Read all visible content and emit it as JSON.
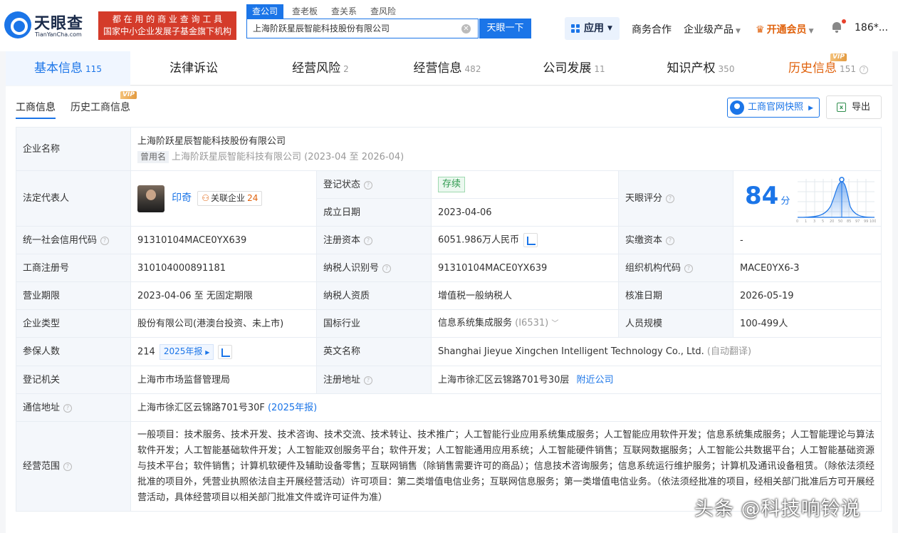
{
  "header": {
    "logo_text": "天眼查",
    "logo_sub": "TianYanCha.com",
    "slogan_line1": "都 在 用 的 商 业 查 询 工 具",
    "slogan_line2": "国家中小企业发展子基金旗下机构",
    "search_tabs": [
      "查公司",
      "查老板",
      "查关系",
      "查风险"
    ],
    "search_value": "上海阶跃星辰智能科技股份有限公司",
    "search_button": "天眼一下",
    "app_button": "应用",
    "nav": {
      "cooperation": "商务合作",
      "enterprise": "企业级产品",
      "vip": "开通会员",
      "user": "186*..."
    },
    "accent": "#1b75e8",
    "brand_red": "#d43b2a"
  },
  "main_tabs": [
    {
      "label": "基本信息",
      "count": "115"
    },
    {
      "label": "法律诉讼",
      "count": ""
    },
    {
      "label": "经营风险",
      "count": "2"
    },
    {
      "label": "经营信息",
      "count": "482"
    },
    {
      "label": "公司发展",
      "count": "11"
    },
    {
      "label": "知识产权",
      "count": "350"
    },
    {
      "label": "历史信息",
      "count": "151",
      "badge": "VIP"
    }
  ],
  "sub_tabs": {
    "t1": "工商信息",
    "t2": "历史工商信息",
    "badge": "VIP"
  },
  "actions": {
    "official": "工商官网快照",
    "export": "导出"
  },
  "info": {
    "company_name_label": "企业名称",
    "company_name": "上海阶跃星辰智能科技股份有限公司",
    "former_tag": "曾用名",
    "former_name": "上海阶跃星辰智能科技有限公司 (2023-04 至 2026-04)",
    "legal_rep_label": "法定代表人",
    "legal_rep": "印奇",
    "assoc_label": "关联企业",
    "assoc_count": "24",
    "reg_status_label": "登记状态",
    "reg_status": "存续",
    "found_date_label": "成立日期",
    "found_date": "2023-04-06",
    "score_label": "天眼评分",
    "score": "84",
    "score_unit": "分",
    "score_axis": [
      "0",
      "1",
      "3",
      "5",
      "20",
      "50",
      "85",
      "97",
      "99",
      "100"
    ],
    "credit_code_label": "统一社会信用代码",
    "credit_code": "91310104MACE0YX639",
    "reg_capital_label": "注册资本",
    "reg_capital": "6051.986万人民币",
    "paid_capital_label": "实缴资本",
    "paid_capital": "-",
    "biz_reg_no_label": "工商注册号",
    "biz_reg_no": "310104000891181",
    "taxpayer_id_label": "纳税人识别号",
    "taxpayer_id": "91310104MACE0YX639",
    "org_code_label": "组织机构代码",
    "org_code": "MACE0YX6-3",
    "biz_term_label": "营业期限",
    "biz_term": "2023-04-06 至 无固定期限",
    "taxpayer_qual_label": "纳税人资质",
    "taxpayer_qual": "增值税一般纳税人",
    "approve_date_label": "核准日期",
    "approve_date": "2026-05-19",
    "company_type_label": "企业类型",
    "company_type": "股份有限公司(港澳台投资、未上市)",
    "industry_label": "国标行业",
    "industry": "信息系统集成服务",
    "industry_code": "(I6531)",
    "staff_size_label": "人员规模",
    "staff_size": "100-499人",
    "insured_label": "参保人数",
    "insured": "214",
    "insured_year": "2025年报",
    "english_name_label": "英文名称",
    "english_name": "Shanghai Jieyue Xingchen Intelligent Technology Co., Ltd.",
    "auto_translate": "(自动翻译)",
    "reg_authority_label": "登记机关",
    "reg_authority": "上海市市场监督管理局",
    "reg_address_label": "注册地址",
    "reg_address": "上海市徐汇区云锦路701号30层",
    "nearby": "附近公司",
    "contact_address_label": "通信地址",
    "contact_address": "上海市徐汇区云锦路701号30F",
    "contact_year": "(2025年报)",
    "scope_label": "经营范围",
    "scope": "一般项目：技术服务、技术开发、技术咨询、技术交流、技术转让、技术推广；人工智能行业应用系统集成服务；人工智能应用软件开发；信息系统集成服务；人工智能理论与算法软件开发；人工智能基础软件开发；人工智能双创服务平台；软件开发；人工智能通用应用系统；人工智能硬件销售；互联网数据服务；人工智能公共数据平台；人工智能基础资源与技术平台；软件销售；计算机软硬件及辅助设备零售；互联网销售（除销售需要许可的商品）；信息技术咨询服务；信息系统运行维护服务；计算机及通讯设备租赁。（除依法须经批准的项目外，凭营业执照依法自主开展经营活动）许可项目：第二类增值电信业务；互联网信息服务；第一类增值电信业务。（依法须经批准的项目，经相关部门批准后方可开展经营活动，具体经营项目以相关部门批准文件或许可证件为准）"
  },
  "watermark": "头条 @科技响铃说"
}
